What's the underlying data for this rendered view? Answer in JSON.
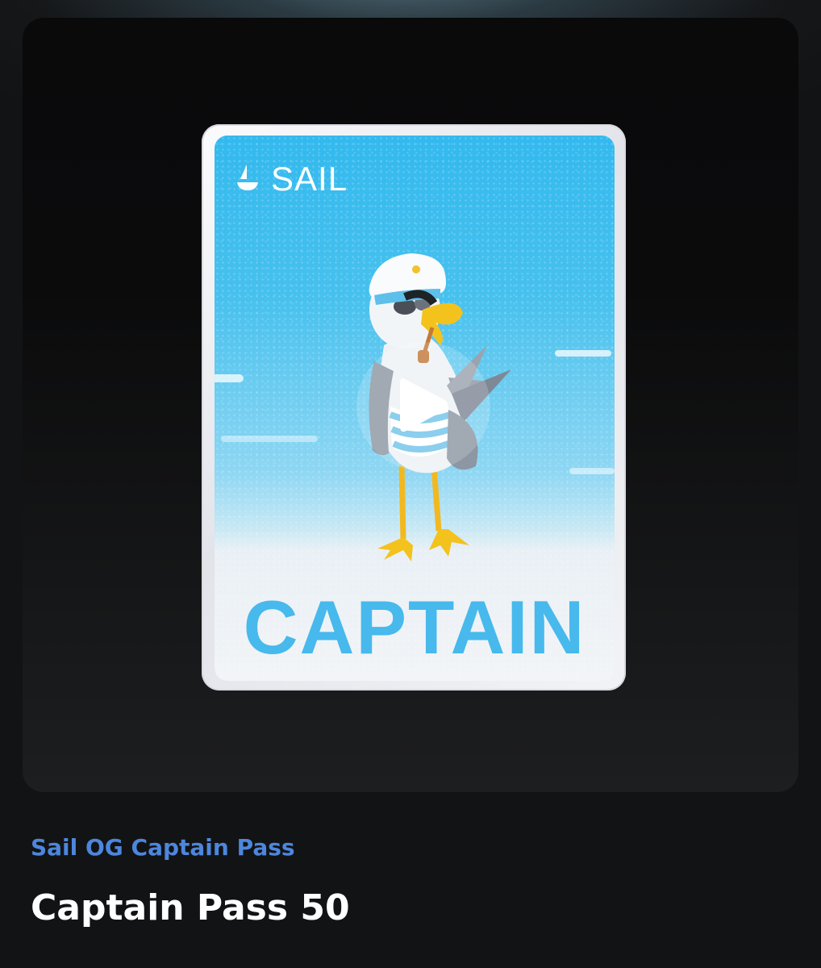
{
  "card": {
    "brand": "SAIL",
    "word": "CAPTAIN",
    "icons": {
      "brand_logo": "sailboat-icon",
      "play": "play-icon"
    },
    "colors": {
      "sky": "#47c1ee",
      "captain_text": "#47b9ec",
      "beak": "#f4c21d"
    }
  },
  "item": {
    "collection": "Sail OG Captain Pass",
    "title": "Captain Pass 50"
  },
  "colors": {
    "background": "#121315",
    "collection_link": "#4d86dc",
    "title": "#ffffff"
  }
}
